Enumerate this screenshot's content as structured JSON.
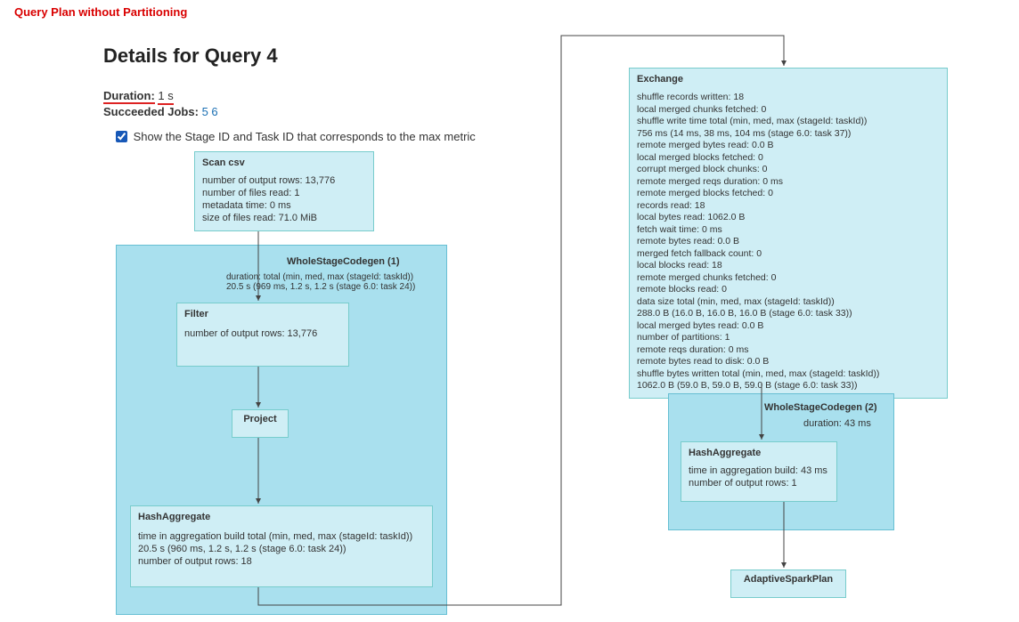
{
  "annotation": "Query Plan without Partitioning",
  "header": {
    "title": "Details for Query 4",
    "duration_label": "Duration:",
    "duration_value": "1 s",
    "succeeded_label": "Succeeded Jobs:",
    "succeeded_jobs": [
      "5",
      "6"
    ]
  },
  "checkbox": {
    "label": "Show the Stage ID and Task ID that corresponds to the max metric",
    "checked": true
  },
  "left": {
    "scan": {
      "title": "Scan csv",
      "rows": [
        "number of output rows: 13,776",
        "number of files read: 1",
        "metadata time: 0 ms",
        "size of files read: 71.0 MiB"
      ]
    },
    "wsc1": {
      "title": "WholeStageCodegen (1)",
      "sub1": "duration: total (min, med, max (stageId: taskId))",
      "sub2": "20.5 s (969 ms, 1.2 s, 1.2 s (stage 6.0: task 24))"
    },
    "filter": {
      "title": "Filter",
      "line": "number of output rows: 13,776"
    },
    "project": {
      "title": "Project"
    },
    "hash1": {
      "title": "HashAggregate",
      "rows": [
        "time in aggregation build total (min, med, max (stageId: taskId))",
        "20.5 s (960 ms, 1.2 s, 1.2 s (stage 6.0: task 24))",
        "number of output rows: 18"
      ]
    }
  },
  "right": {
    "exchange": {
      "title": "Exchange",
      "rows": [
        "shuffle records written: 18",
        "local merged chunks fetched: 0",
        "shuffle write time total (min, med, max (stageId: taskId))",
        "756 ms (14 ms, 38 ms, 104 ms (stage 6.0: task 37))",
        "remote merged bytes read: 0.0 B",
        "local merged blocks fetched: 0",
        "corrupt merged block chunks: 0",
        "remote merged reqs duration: 0 ms",
        "remote merged blocks fetched: 0",
        "records read: 18",
        "local bytes read: 1062.0 B",
        "fetch wait time: 0 ms",
        "remote bytes read: 0.0 B",
        "merged fetch fallback count: 0",
        "local blocks read: 18",
        "remote merged chunks fetched: 0",
        "remote blocks read: 0",
        "data size total (min, med, max (stageId: taskId))",
        "288.0 B (16.0 B, 16.0 B, 16.0 B (stage 6.0: task 33))",
        "local merged bytes read: 0.0 B",
        "number of partitions: 1",
        "remote reqs duration: 0 ms",
        "remote bytes read to disk: 0.0 B",
        "shuffle bytes written total (min, med, max (stageId: taskId))",
        "1062.0 B (59.0 B, 59.0 B, 59.0 B (stage 6.0: task 33))"
      ]
    },
    "wsc2": {
      "title": "WholeStageCodegen (2)",
      "sub": "duration: 43 ms"
    },
    "hash2": {
      "title": "HashAggregate",
      "rows": [
        "time in aggregation build: 43 ms",
        "number of output rows: 1"
      ]
    },
    "asp": {
      "title": "AdaptiveSparkPlan"
    }
  }
}
